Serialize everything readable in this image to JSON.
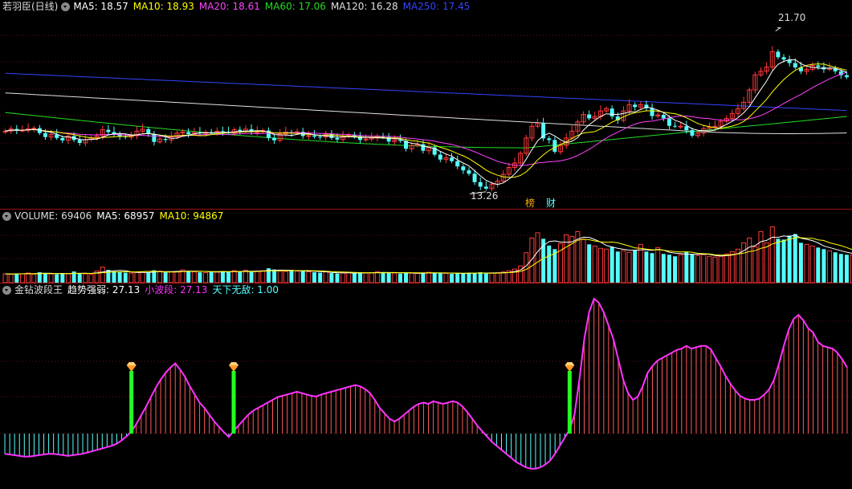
{
  "colors": {
    "ma5": "#ffffff",
    "ma10": "#ffff00",
    "ma20": "#ff44ff",
    "ma60": "#22dd22",
    "ma120": "#e0e0e0",
    "ma250": "#3344ff",
    "up": "#ff3a3a",
    "down": "#54ffff",
    "trend": "#ff33ff",
    "cyan": "#54ffff",
    "signal": "#22ff22"
  },
  "panel1": {
    "title": "若羽臣(日线)",
    "ma5": "MA5: 18.57",
    "ma10": "MA10: 18.93",
    "ma20": "MA20: 18.61",
    "ma60": "MA60: 17.06",
    "ma120": "MA120: 16.28",
    "ma250": "MA250: 17.45",
    "high_label": "21.70",
    "low_label": "13.26",
    "tag1": "榜",
    "tag2": "财"
  },
  "panel2": {
    "title": "VOLUME: 69406",
    "ma5": "MA5: 68957",
    "ma10": "MA10: 94867"
  },
  "panel3": {
    "title": "金钻波段王",
    "trend": "趋势强弱: 27.13",
    "small": "小波段: 27.13",
    "invincible": "天下无敌: 1.00"
  },
  "chart_data": [
    {
      "type": "candlestick",
      "title": "若羽臣(日线)",
      "y_range": [
        13.26,
        21.7
      ],
      "x": [
        0,
        1,
        2,
        3,
        4,
        5,
        6,
        7,
        8,
        9,
        10,
        11,
        12,
        13,
        14,
        15,
        16,
        17,
        18,
        19,
        20,
        21,
        22,
        23,
        24,
        25,
        26,
        27,
        28,
        29,
        30,
        31,
        32,
        33,
        34,
        35,
        36,
        37,
        38,
        39,
        40,
        41,
        42,
        43,
        44,
        45,
        46,
        47,
        48,
        49,
        50,
        51,
        52,
        53,
        54,
        55,
        56,
        57,
        58,
        59,
        60,
        61,
        62,
        63,
        64,
        65,
        66,
        67,
        68,
        69,
        70,
        71,
        72,
        73,
        74,
        75,
        76,
        77,
        78,
        79,
        80,
        81,
        82,
        83,
        84,
        85,
        86,
        87,
        88,
        89,
        90,
        91,
        92,
        93,
        94,
        95,
        96,
        97,
        98,
        99,
        100,
        101,
        102,
        103,
        104,
        105,
        106,
        107,
        108,
        109,
        110,
        111,
        112,
        113,
        114,
        115,
        116,
        117,
        118,
        119,
        120,
        121,
        122,
        123,
        124,
        125,
        126,
        127,
        128,
        129,
        130,
        131,
        132,
        133,
        134,
        135,
        136,
        137,
        138,
        139,
        140,
        141,
        142,
        143,
        144,
        145,
        146,
        147,
        148,
        149
      ],
      "close": [
        16.35,
        16.46,
        16.38,
        16.4,
        16.47,
        16.5,
        16.25,
        16.05,
        16.18,
        16.0,
        15.88,
        16.1,
        15.9,
        15.75,
        15.92,
        16.02,
        16.1,
        16.42,
        16.3,
        16.22,
        16.08,
        16.04,
        16.12,
        16.35,
        16.45,
        16.2,
        15.8,
        15.95,
        15.9,
        16.05,
        16.25,
        16.3,
        16.2,
        16.28,
        16.24,
        16.3,
        16.26,
        16.34,
        16.3,
        16.25,
        16.42,
        16.36,
        16.45,
        16.3,
        16.32,
        16.38,
        16.0,
        15.88,
        16.2,
        16.3,
        16.25,
        16.32,
        16.1,
        16.12,
        16.07,
        16.05,
        16.2,
        16.0,
        15.92,
        16.08,
        16.15,
        16.1,
        15.9,
        15.95,
        16.0,
        16.1,
        16.05,
        15.82,
        15.9,
        15.85,
        15.45,
        15.62,
        15.68,
        15.35,
        15.52,
        15.15,
        14.9,
        15.0,
        14.82,
        14.55,
        14.35,
        14.18,
        13.75,
        13.52,
        13.42,
        13.65,
        13.8,
        14.15,
        14.5,
        14.72,
        15.22,
        16.0,
        16.6,
        16.75,
        15.98,
        15.9,
        15.3,
        15.62,
        16.0,
        16.35,
        16.82,
        17.2,
        17.0,
        17.1,
        17.38,
        17.5,
        17.1,
        16.9,
        17.38,
        17.7,
        17.58,
        17.7,
        17.52,
        17.12,
        17.18,
        17.0,
        16.62,
        16.6,
        16.6,
        16.4,
        16.12,
        16.25,
        16.48,
        16.55,
        16.6,
        16.85,
        17.0,
        17.25,
        17.5,
        17.82,
        18.45,
        19.22,
        19.4,
        19.62,
        20.4,
        20.12,
        20.0,
        19.82,
        19.6,
        19.4,
        19.5,
        19.7,
        19.62,
        19.5,
        19.55,
        19.4,
        19.2,
        19.1
      ],
      "open": [
        16.3,
        16.35,
        16.46,
        16.38,
        16.4,
        16.47,
        16.5,
        16.25,
        16.05,
        16.18,
        16.0,
        15.88,
        16.1,
        15.9,
        15.75,
        15.92,
        16.02,
        16.1,
        16.42,
        16.3,
        16.22,
        16.08,
        16.04,
        16.12,
        16.35,
        16.45,
        16.2,
        15.8,
        15.95,
        15.9,
        16.05,
        16.25,
        16.3,
        16.2,
        16.28,
        16.24,
        16.3,
        16.26,
        16.34,
        16.3,
        16.25,
        16.42,
        16.36,
        16.45,
        16.3,
        16.32,
        16.38,
        16.0,
        15.88,
        16.2,
        16.3,
        16.25,
        16.32,
        16.1,
        16.12,
        16.07,
        16.05,
        16.2,
        16.0,
        15.92,
        16.08,
        16.15,
        16.1,
        15.9,
        15.95,
        16.0,
        16.1,
        16.05,
        15.82,
        15.9,
        15.85,
        15.45,
        15.62,
        15.68,
        15.35,
        15.52,
        15.15,
        14.9,
        15.0,
        14.82,
        14.55,
        14.35,
        14.18,
        13.75,
        13.52,
        13.42,
        13.65,
        13.8,
        14.15,
        14.5,
        14.72,
        15.22,
        16.0,
        16.6,
        16.75,
        15.98,
        15.9,
        15.3,
        15.62,
        16.0,
        16.35,
        16.82,
        17.2,
        17.0,
        17.1,
        17.38,
        17.5,
        17.1,
        16.9,
        17.38,
        17.7,
        17.58,
        17.7,
        17.52,
        17.12,
        17.18,
        17.0,
        16.62,
        16.6,
        16.6,
        16.4,
        16.12,
        16.25,
        16.48,
        16.55,
        16.6,
        16.85,
        17.0,
        17.25,
        17.5,
        17.82,
        18.45,
        19.22,
        19.4,
        19.62,
        20.4,
        20.12,
        20.0,
        19.82,
        19.6,
        19.4,
        19.5,
        19.7,
        19.62,
        19.5,
        19.55,
        19.4,
        19.2
      ]
    },
    {
      "type": "bar",
      "title": "VOLUME: 69406",
      "values": [
        22000,
        21000,
        23000,
        22500,
        24000,
        21000,
        26000,
        24000,
        22000,
        21000,
        23000,
        22000,
        28000,
        23000,
        22000,
        21000,
        29000,
        39000,
        32000,
        28000,
        26000,
        25000,
        24000,
        26000,
        27000,
        25000,
        31000,
        29000,
        26000,
        27000,
        28000,
        32000,
        30000,
        27000,
        26000,
        25000,
        28000,
        27000,
        29000,
        26000,
        30000,
        28000,
        31000,
        27000,
        29000,
        30000,
        36000,
        33000,
        29000,
        28000,
        30000,
        29000,
        31000,
        27000,
        26000,
        25000,
        27000,
        24000,
        23000,
        24000,
        25000,
        24000,
        26000,
        24000,
        25000,
        27000,
        26000,
        25000,
        24000,
        23000,
        25000,
        24000,
        23000,
        24000,
        26000,
        25000,
        24000,
        23000,
        22000,
        24000,
        23000,
        25000,
        24000,
        26000,
        23000,
        24000,
        25000,
        27000,
        30000,
        34000,
        42000,
        75000,
        112000,
        125000,
        110000,
        93000,
        84000,
        98000,
        120000,
        116000,
        128000,
        108000,
        96000,
        92000,
        86000,
        84000,
        90000,
        78000,
        80000,
        76000,
        82000,
        96000,
        78000,
        74000,
        88000,
        72000,
        70000,
        66000,
        70000,
        78000,
        72000,
        68000,
        70000,
        66000,
        64000,
        66000,
        72000,
        78000,
        84000,
        100000,
        112000,
        90000,
        128000,
        100000,
        140000,
        110000,
        108000,
        118000,
        122000,
        100000,
        96000,
        92000,
        88000,
        84000,
        80000,
        76000,
        72000,
        70000,
        69406
      ]
    },
    {
      "type": "bar",
      "title": "金钻波段王",
      "values": [
        -30,
        -31,
        -32,
        -33,
        -34,
        -34,
        -33,
        -32,
        -31,
        -30,
        -30,
        -31,
        -32,
        -33,
        -32,
        -31,
        -30,
        -28,
        -26,
        -24,
        -22,
        -20,
        -18,
        -15,
        -10,
        -4,
        3,
        14,
        27,
        40,
        54,
        68,
        80,
        90,
        98,
        104,
        95,
        84,
        70,
        58,
        46,
        38,
        28,
        18,
        10,
        2,
        -5,
        4,
        12,
        20,
        28,
        34,
        38,
        42,
        46,
        50,
        54,
        56,
        58,
        60,
        62,
        60,
        58,
        56,
        55,
        58,
        60,
        62,
        64,
        66,
        68,
        70,
        72,
        70,
        66,
        60,
        50,
        38,
        30,
        22,
        18,
        22,
        28,
        34,
        40,
        44,
        46,
        44,
        48,
        46,
        44,
        46,
        48,
        46,
        40,
        32,
        22,
        12,
        4,
        -4,
        -12,
        -18,
        -24,
        -30,
        -36,
        -42,
        -46,
        -50,
        -52,
        -52,
        -50,
        -46,
        -40,
        -30,
        -18,
        -6,
        6,
        28,
        80,
        140,
        180,
        200,
        194,
        180,
        160,
        140,
        110,
        80,
        60,
        50,
        55,
        70,
        90,
        100,
        108,
        112,
        116,
        120,
        124,
        126,
        130,
        126,
        128,
        130,
        130,
        125,
        112,
        100,
        86,
        74,
        64,
        56,
        52,
        50,
        50,
        52,
        58,
        66,
        80,
        104,
        130,
        154,
        170,
        176,
        168,
        156,
        150,
        136,
        130,
        128,
        126,
        120,
        110,
        98
      ]
    }
  ]
}
